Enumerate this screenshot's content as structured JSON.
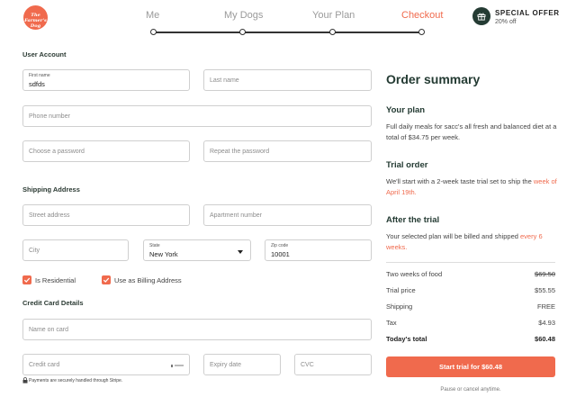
{
  "header": {
    "logo_text": "The Farmer's Dog",
    "steps": [
      "Me",
      "My Dogs",
      "Your Plan",
      "Checkout"
    ],
    "offer_title": "SPECIAL OFFER",
    "offer_sub": "20% off"
  },
  "form": {
    "user_account_label": "User Account",
    "first_name_label": "First name",
    "first_name_value": "sdfds",
    "last_name_placeholder": "Last name",
    "phone_placeholder": "Phone number",
    "password_placeholder": "Choose a password",
    "repeat_password_placeholder": "Repeat the password",
    "shipping_label": "Shipping Address",
    "street_placeholder": "Street address",
    "apartment_placeholder": "Apartment number",
    "city_placeholder": "City",
    "state_label": "State",
    "state_value": "New York",
    "zip_label": "Zip code",
    "zip_value": "10001",
    "residential_label": "Is Residential",
    "billing_label": "Use as Billing Address",
    "residential_checked": true,
    "billing_checked": true,
    "credit_card_label": "Credit Card Details",
    "name_on_card_placeholder": "Name on card",
    "credit_card_placeholder": "Credit card",
    "expiry_placeholder": "Expiry date",
    "cvc_placeholder": "CVC",
    "stripe_note": "Payments are securely handled through Stripe."
  },
  "summary": {
    "title": "Order summary",
    "your_plan_heading": "Your plan",
    "your_plan_text": "Full daily meals for sacc's all fresh and balanced diet at a total of $34.75 per week.",
    "trial_heading": "Trial order",
    "trial_text": "We'll start with a 2-week taste trial set to ship the",
    "trial_highlight": "week of April 19th.",
    "after_heading": "After the trial",
    "after_text": "Your selected plan will be billed and shipped",
    "after_highlight": "every 6 weeks.",
    "rows": [
      {
        "label": "Two weeks of food",
        "value": "$69.50"
      },
      {
        "label": "Trial price",
        "value": "$55.55"
      },
      {
        "label": "Shipping",
        "value": "FREE"
      },
      {
        "label": "Tax",
        "value": "$4.93"
      },
      {
        "label": "Today's total",
        "value": "$60.48"
      }
    ],
    "cta": "Start trial for $60.48",
    "cancel_note": "Pause or cancel anytime."
  },
  "colors": {
    "accent": "#f06a4d",
    "dark_green": "#243b33"
  }
}
